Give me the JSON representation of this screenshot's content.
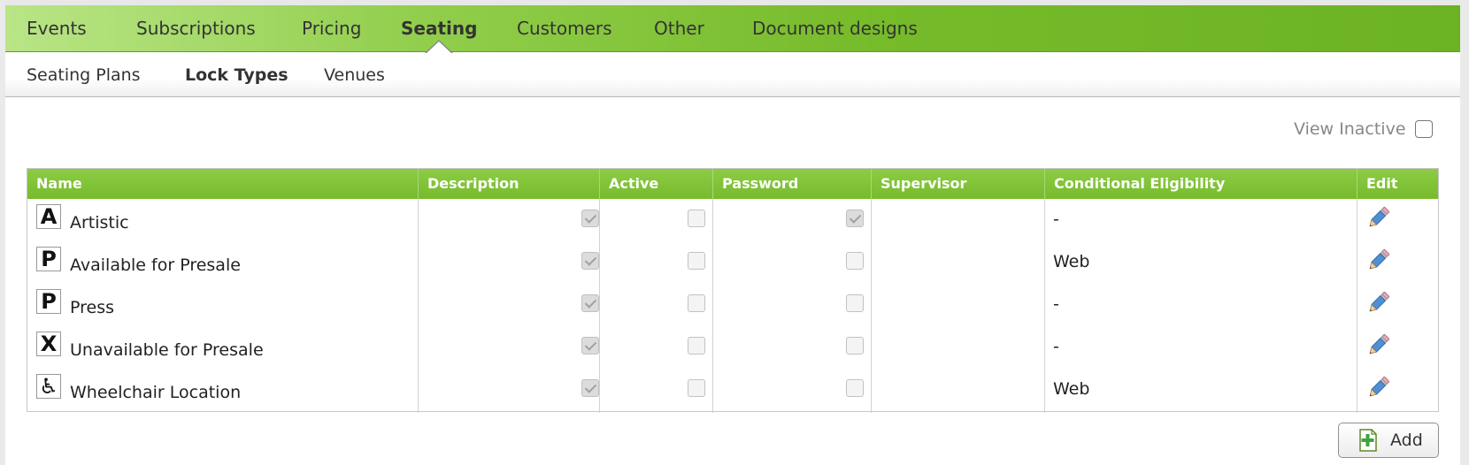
{
  "main_nav": {
    "tabs": [
      "Events",
      "Subscriptions",
      "Pricing",
      "Seating",
      "Customers",
      "Other",
      "Document designs"
    ],
    "active": "Seating"
  },
  "sub_nav": {
    "tabs": [
      "Seating Plans",
      "Lock Types",
      "Venues"
    ],
    "active": "Lock Types"
  },
  "view_inactive": {
    "label": "View Inactive",
    "checked": false
  },
  "table": {
    "columns": [
      "Name",
      "Description",
      "Active",
      "Password",
      "Supervisor",
      "Conditional Eligibility",
      "Edit"
    ],
    "rows": [
      {
        "icon": "A",
        "icon_name": "letter-a-icon",
        "name": "Artistic",
        "description": "",
        "active": true,
        "password": false,
        "supervisor": true,
        "eligibility": "-"
      },
      {
        "icon": "P",
        "icon_name": "letter-p-icon",
        "name": "Available for Presale",
        "description": "",
        "active": true,
        "password": false,
        "supervisor": false,
        "eligibility": "Web"
      },
      {
        "icon": "P",
        "icon_name": "letter-p-icon",
        "name": "Press",
        "description": "",
        "active": true,
        "password": false,
        "supervisor": false,
        "eligibility": "-"
      },
      {
        "icon": "X",
        "icon_name": "letter-x-icon",
        "name": "Unavailable for Presale",
        "description": "",
        "active": true,
        "password": false,
        "supervisor": false,
        "eligibility": "-"
      },
      {
        "icon": "♿",
        "icon_name": "wheelchair-icon",
        "name": "Wheelchair Location",
        "description": "",
        "active": true,
        "password": false,
        "supervisor": false,
        "eligibility": "Web"
      }
    ]
  },
  "add_button": {
    "label": "Add"
  },
  "colors": {
    "nav_green": "#76bb2a",
    "header_green": "#80c236"
  }
}
